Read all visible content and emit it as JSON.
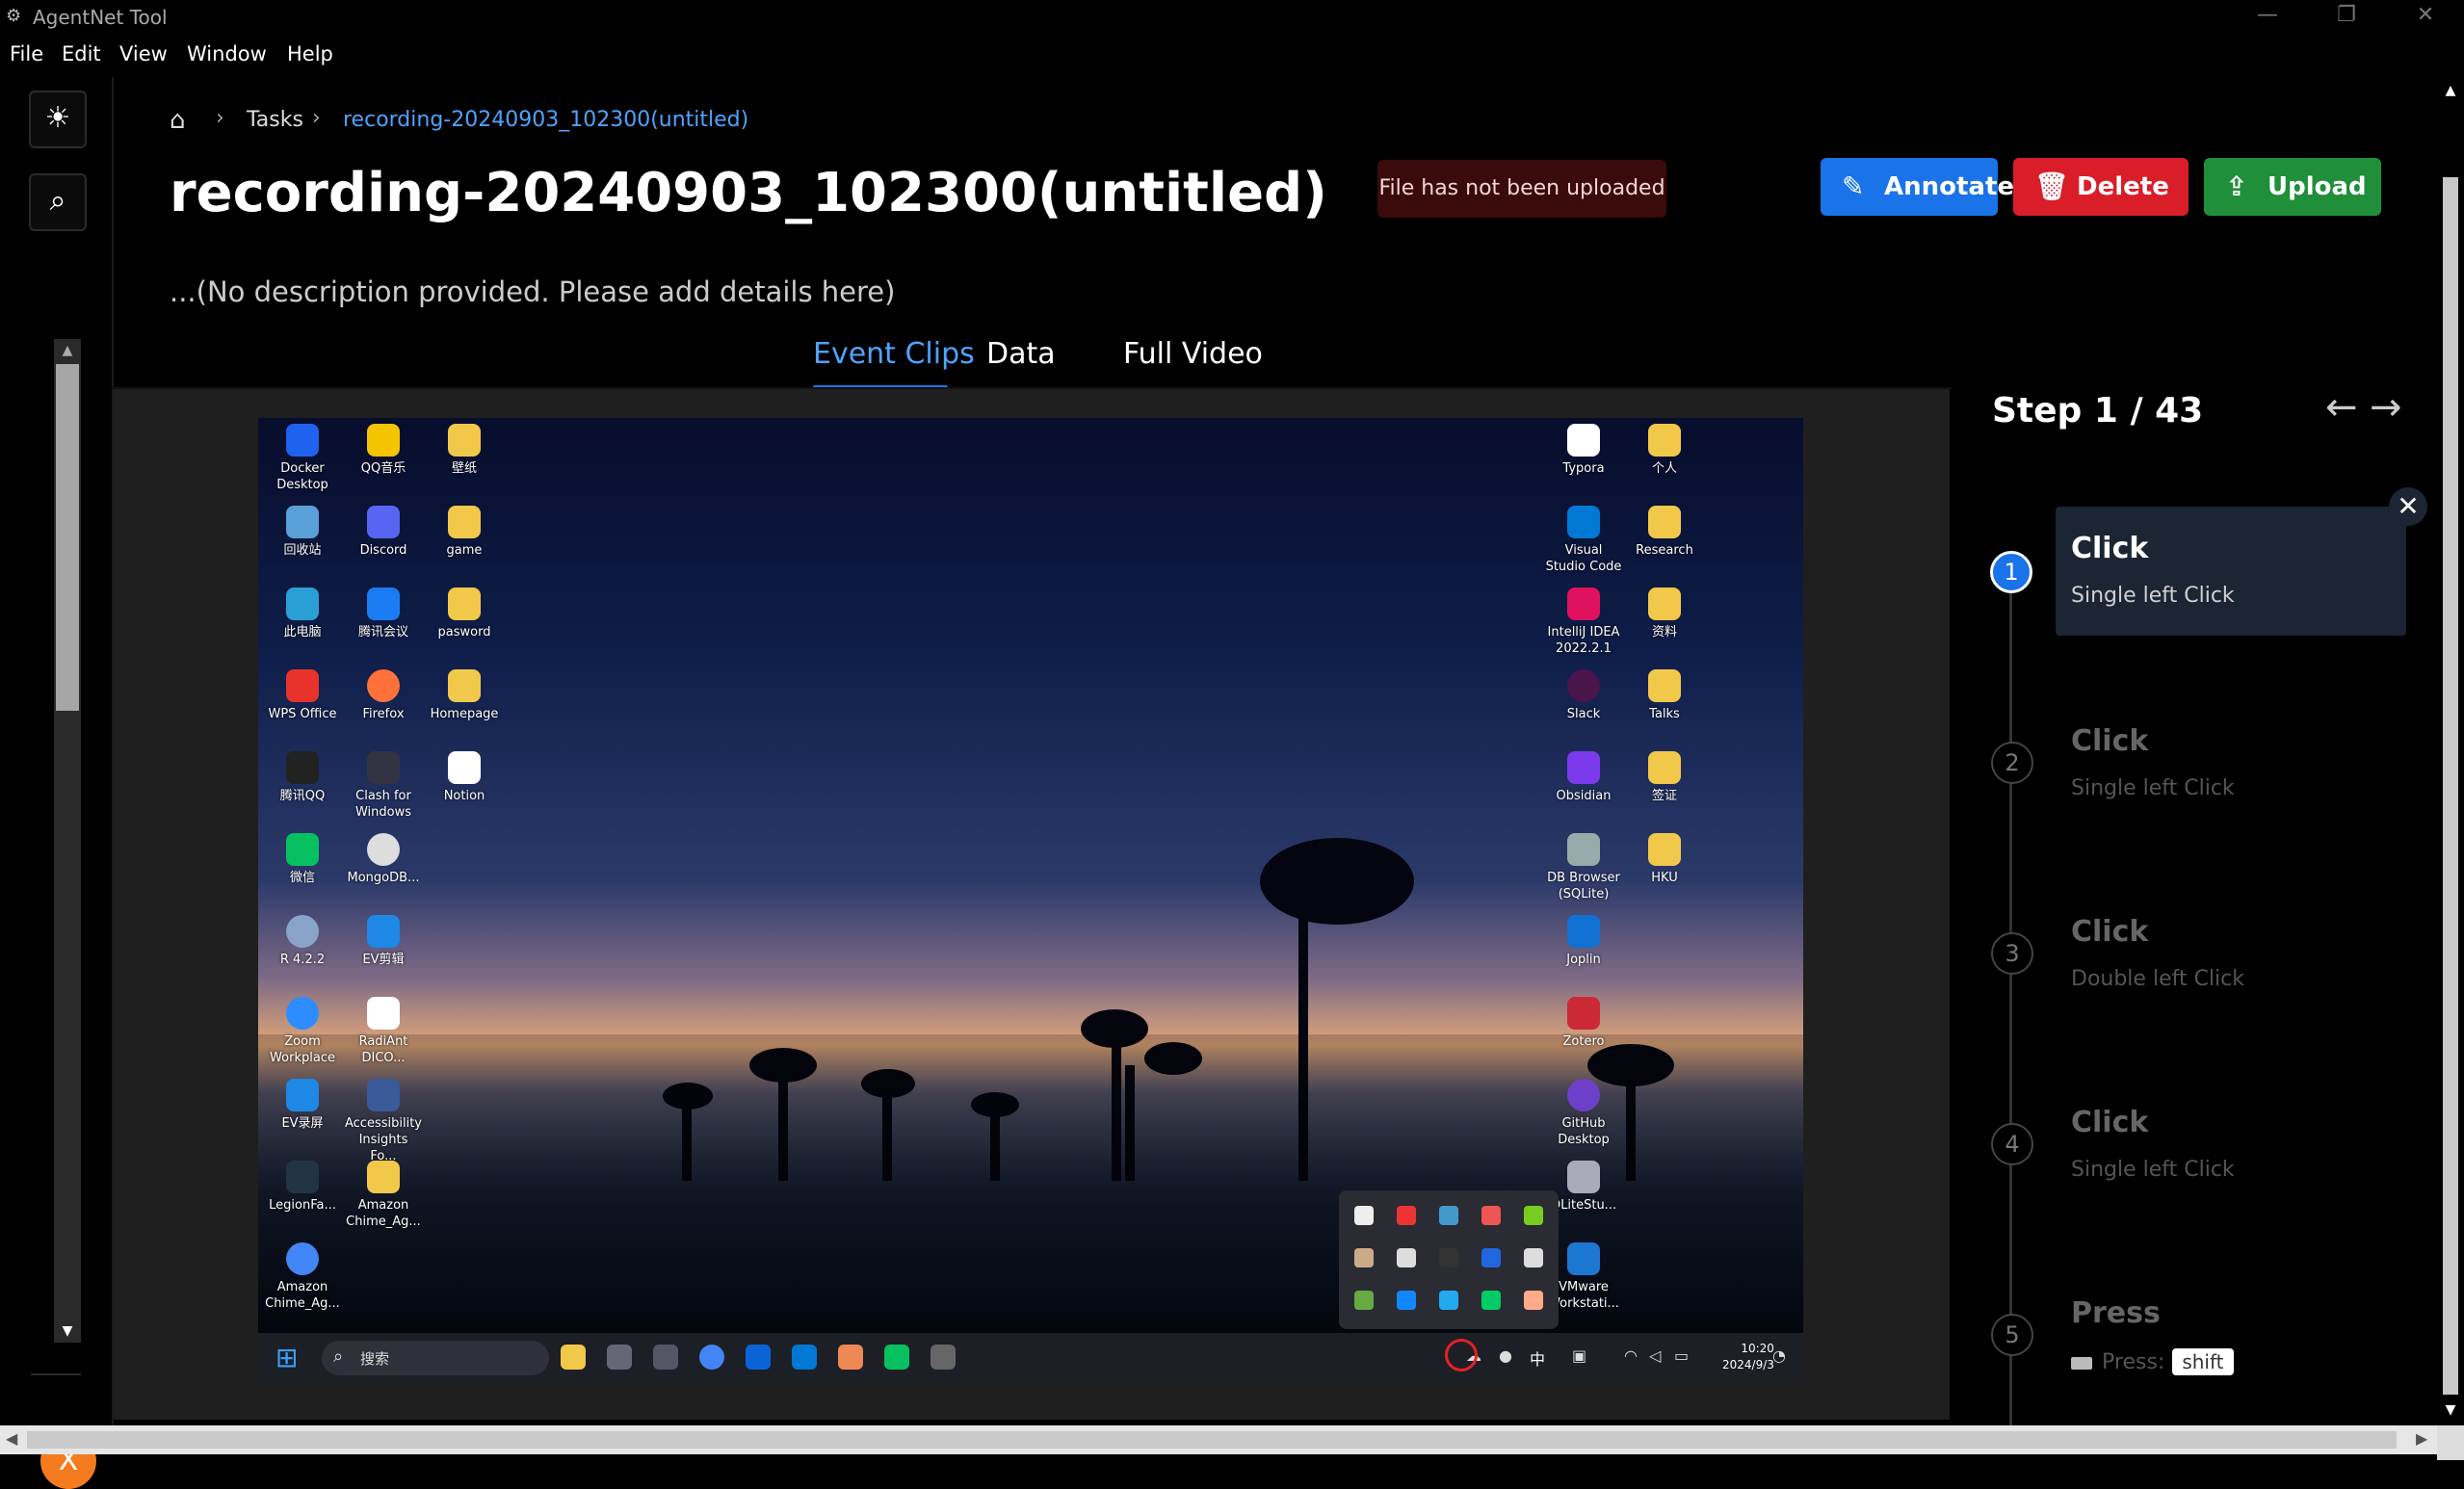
{
  "app": {
    "title": "AgentNet Tool"
  },
  "window_controls": {
    "minimize": "—",
    "restore": "❐",
    "close": "✕"
  },
  "menu": [
    "File",
    "Edit",
    "View",
    "Window",
    "Help"
  ],
  "sidebar": {
    "theme_icon": "☀",
    "search_icon": "⌕",
    "avatar_letter": "X"
  },
  "breadcrumb": {
    "home_icon": "⌂",
    "sep": "›",
    "items": [
      "Tasks",
      "recording-20240903_102300(untitled)"
    ]
  },
  "page": {
    "title": "recording-20240903_102300(untitled)",
    "status": "File has not been uploaded",
    "description": "...(No description provided. Please add details here)"
  },
  "actions": {
    "annotate": {
      "label": "Annotate",
      "icon": "✎"
    },
    "delete": {
      "label": "Delete",
      "icon": "🗑"
    },
    "upload": {
      "label": "Upload",
      "icon": "⇪"
    }
  },
  "tabs": [
    {
      "label": "Event Clips",
      "active": true
    },
    {
      "label": "Data",
      "active": false
    },
    {
      "label": "Full Video",
      "active": false
    }
  ],
  "desktop": {
    "left_icons": [
      [
        "Docker Desktop",
        "QQ音乐",
        "壁纸"
      ],
      [
        "回收站",
        "Discord",
        "game"
      ],
      [
        "此电脑",
        "腾讯会议",
        "pasword"
      ],
      [
        "WPS Office",
        "Firefox",
        "Homepage"
      ],
      [
        "腾讯QQ",
        "Clash for Windows",
        "Notion"
      ],
      [
        "微信",
        "MongoDB...",
        ""
      ],
      [
        "R 4.2.2",
        "EV剪辑",
        ""
      ],
      [
        "Zoom Workplace",
        "RadiAnt DICO...",
        ""
      ],
      [
        "EV录屏",
        "Accessibility Insights Fo...",
        ""
      ],
      [
        "LegionFa...",
        "Amazon Chime_Ag...",
        ""
      ],
      [
        "Amazon Chime_Ag...",
        "",
        ""
      ]
    ],
    "right_icons": [
      [
        "Typora",
        "个人"
      ],
      [
        "Visual Studio Code",
        "Research"
      ],
      [
        "IntelliJ IDEA 2022.2.1",
        "资料"
      ],
      [
        "Slack",
        "Talks"
      ],
      [
        "Obsidian",
        "签证"
      ],
      [
        "DB Browser (SQLite)",
        "HKU"
      ],
      [
        "Joplin",
        ""
      ],
      [
        "Zotero",
        ""
      ],
      [
        "GitHub Desktop",
        ""
      ],
      [
        "QLiteStu...",
        ""
      ],
      [
        "VMware Workstati...",
        ""
      ]
    ],
    "taskbar": {
      "search_placeholder": "搜索",
      "ime": "中",
      "time": "10:20",
      "date": "2024/9/3"
    }
  },
  "steps": {
    "counter": "Step 1 / 43",
    "prev_icon": "←",
    "next_icon": "→",
    "close_icon": "✕",
    "items": [
      {
        "num": "1",
        "action": "Click",
        "detail": "Single left Click"
      },
      {
        "num": "2",
        "action": "Click",
        "detail": "Single left Click"
      },
      {
        "num": "3",
        "action": "Click",
        "detail": "Double left Click"
      },
      {
        "num": "4",
        "action": "Click",
        "detail": "Single left Click"
      },
      {
        "num": "5",
        "action": "Press",
        "detail": "Press:",
        "key": "shift"
      }
    ]
  },
  "colors": {
    "accent": "#1a73e8",
    "danger": "#d91e2a",
    "success": "#1f8f3a",
    "badge_bg": "#3b0a0a",
    "link": "#4fa3ff"
  }
}
